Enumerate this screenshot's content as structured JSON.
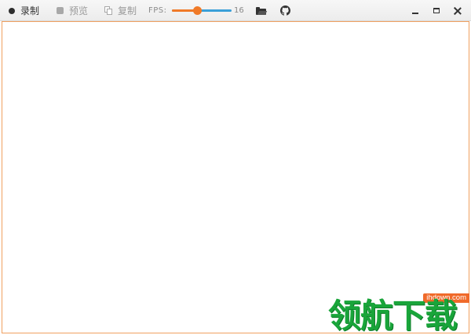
{
  "toolbar": {
    "record_label": "录制",
    "preview_label": "预览",
    "copy_label": "复制",
    "fps_label": "FPS:",
    "fps_value": "16",
    "fps_slider_fraction": 0.42
  },
  "icons": {
    "record": "record-dot-icon",
    "preview": "stop-square-icon",
    "copy": "copy-icon",
    "open": "folder-open-icon",
    "github": "github-icon",
    "minimize": "minimize-icon",
    "maximize": "maximize-icon",
    "close": "close-icon"
  },
  "colors": {
    "accent_orange": "#f07a28",
    "slider_track": "#3aa0d8",
    "canvas_border": "#f0a060",
    "watermark_green": "#19a53a",
    "watermark_badge": "#f06a2a"
  },
  "watermark": {
    "url": "ihdown.com",
    "text": "领航下载"
  }
}
